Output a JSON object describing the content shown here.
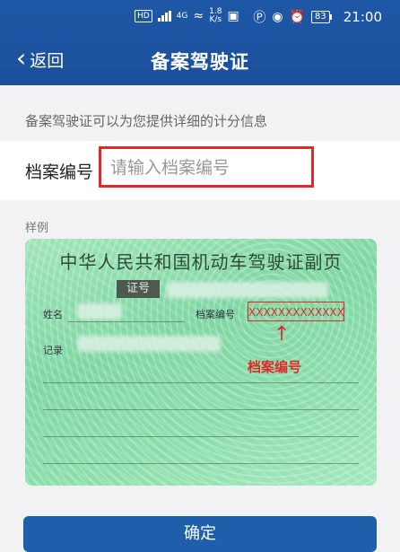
{
  "status_bar": {
    "hd_tag": "HD",
    "network": "4G",
    "speed_value": "1.8",
    "speed_unit": "K/s",
    "battery": "83",
    "time": "21:00"
  },
  "nav": {
    "back_label": "返回",
    "title": "备案驾驶证"
  },
  "hint": "备案驾驶证可以为您提供详细的计分信息",
  "field": {
    "label": "档案编号",
    "placeholder": "请输入档案编号",
    "value": ""
  },
  "example": {
    "label": "样例",
    "card_title": "中华人民共和国机动车驾驶证副页",
    "cert_tag": "证号",
    "name_label": "姓名",
    "file_no_label": "档案编号",
    "record_label": "记录",
    "sample_number": "XXXXXXXXXXXXX",
    "callout": "档案编号"
  },
  "confirm_label": "确定",
  "colors": {
    "header": "#1e58a6",
    "highlight": "#e02a2a",
    "card": "#8ee0ad"
  }
}
